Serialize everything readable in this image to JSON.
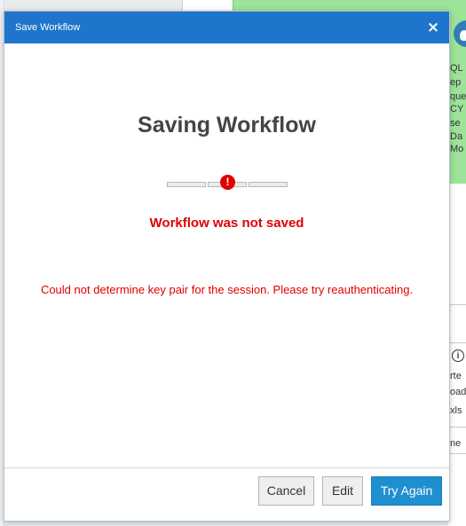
{
  "dialog": {
    "title": "Save Workflow",
    "close_glyph": "×",
    "heading": "Saving Workflow",
    "error_glyph": "!",
    "status": "Workflow was not saved",
    "message": "Could not determine key pair for the session. Please try reauthenticating.",
    "buttons": {
      "cancel": "Cancel",
      "edit": "Edit",
      "try_again": "Try Again"
    }
  },
  "background_fragments": {
    "lines_top": [
      "QL",
      "ep",
      "que",
      "CY",
      "se",
      "Da",
      "Mo"
    ],
    "lines_bottom": [
      "rte",
      "oad",
      "xls",
      "ne"
    ],
    "info_glyph": "i"
  },
  "colors": {
    "header": "#1f75cb",
    "error": "#e00000",
    "primary_button": "#1f8fd0",
    "background_green": "#9de39a"
  },
  "icons": {
    "close": "close-icon",
    "error": "error-icon",
    "info": "info-icon",
    "avatar": "avatar-icon"
  }
}
